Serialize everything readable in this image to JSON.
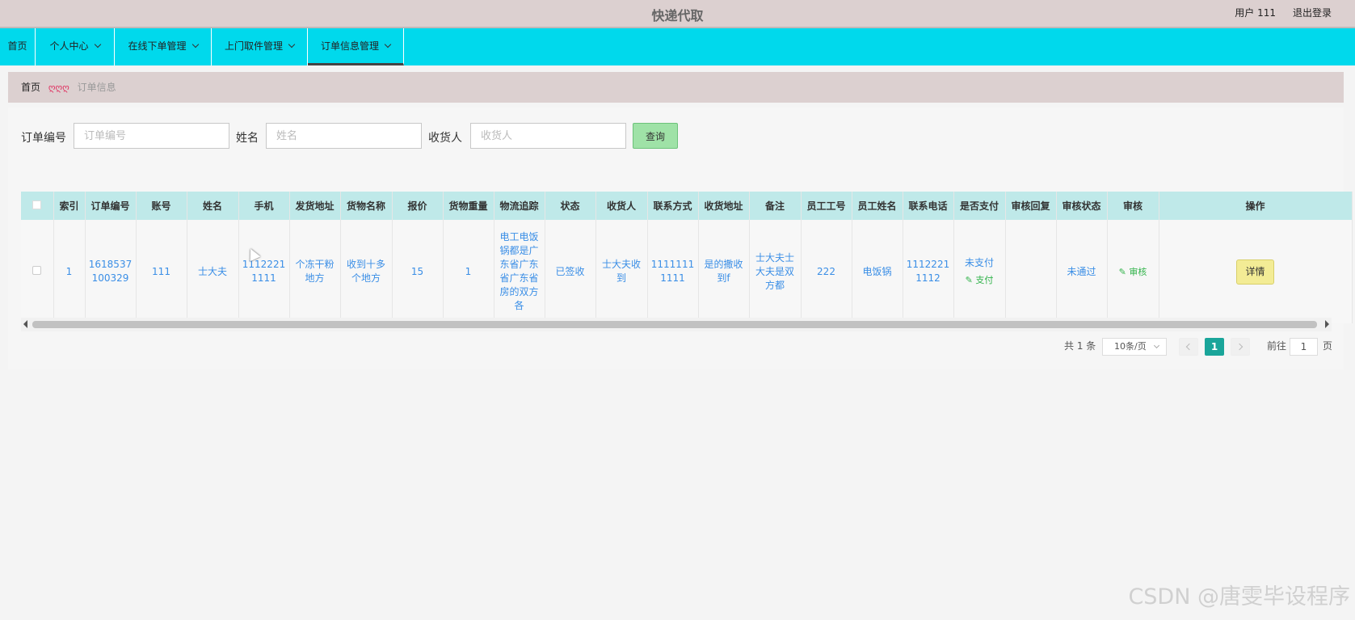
{
  "header": {
    "title": "快递代取",
    "user_label": "用户 111",
    "logout_label": "退出登录"
  },
  "nav": {
    "items": [
      {
        "label": "首页"
      },
      {
        "label": "个人中心"
      },
      {
        "label": "在线下单管理"
      },
      {
        "label": "上门取件管理"
      },
      {
        "label": "订单信息管理"
      }
    ],
    "active_index": 4
  },
  "breadcrumb": {
    "home": "首页",
    "separator": "ღღღ",
    "current": "订单信息"
  },
  "search": {
    "order_no_label": "订单编号",
    "order_no_placeholder": "订单编号",
    "name_label": "姓名",
    "name_placeholder": "姓名",
    "receiver_label": "收货人",
    "receiver_placeholder": "收货人",
    "query_button": "查询"
  },
  "table": {
    "headers": [
      "索引",
      "订单编号",
      "账号",
      "姓名",
      "手机",
      "发货地址",
      "货物名称",
      "报价",
      "货物重量",
      "物流追踪",
      "状态",
      "收货人",
      "联系方式",
      "收货地址",
      "备注",
      "员工工号",
      "员工姓名",
      "联系电话",
      "是否支付",
      "审核回复",
      "审核状态",
      "审核",
      "操作"
    ],
    "rows": [
      {
        "index": "1",
        "order_no": "1618537100329",
        "account": "111",
        "name": "士大夫",
        "phone": "11122211111",
        "ship_address": "个冻干粉地方",
        "goods_name": "收到十多个地方",
        "price": "15",
        "weight": "1",
        "tracking": "电工电饭锅都是广东省广东省广东省房的双方各",
        "status": "已签收",
        "receiver": "士大夫收到",
        "contact": "11111111111",
        "receive_address": "是的撒收到f",
        "remark": "士大夫士大夫是双方都",
        "staff_no": "222",
        "staff_name": "电饭锅",
        "staff_phone": "11122211112",
        "paid": "未支付",
        "pay_action": "支付",
        "review_reply": "",
        "review_status": "未通过",
        "review_action": "审核",
        "detail_button": "详情"
      }
    ]
  },
  "pagination": {
    "total": "共 1 条",
    "page_size": "10条/页",
    "current_page": "1",
    "goto_label": "前往",
    "goto_value": "1",
    "page_suffix": "页"
  },
  "watermark": "CSDN @唐雯毕设程序",
  "colors": {
    "nav_bg": "#00d9ec",
    "header_bg": "#dcd0d0",
    "table_header_bg": "#bfe9e9",
    "link_blue": "#3a8ee6",
    "accent_teal": "#1aa59a"
  }
}
